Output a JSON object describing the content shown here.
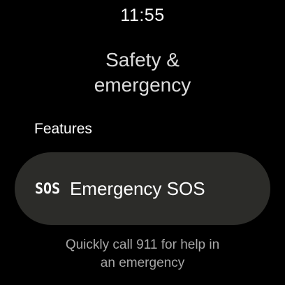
{
  "status_bar": {
    "time": "11:55"
  },
  "header": {
    "title_line1": "Safety &",
    "title_line2": "emergency"
  },
  "features_section": {
    "label": "Features",
    "items": [
      {
        "icon": "sos-icon",
        "icon_text": "SOS",
        "label": "Emergency SOS",
        "description_line1": "Quickly call 911 for help in",
        "description_line2": "an emergency"
      }
    ]
  },
  "colors": {
    "background": "#000000",
    "chip_background": "#2c2c29",
    "primary_text": "#ffffff",
    "secondary_text": "#a8a8a8"
  }
}
